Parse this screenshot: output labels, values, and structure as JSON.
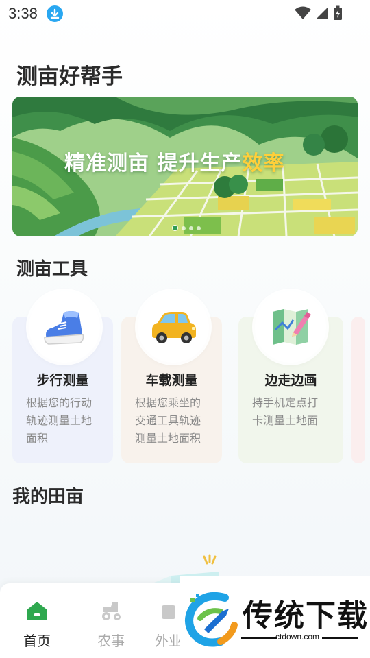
{
  "status_bar": {
    "time": "3:38"
  },
  "app": {
    "title": "测亩好帮手"
  },
  "banner": {
    "headline_main": "精准测亩  提升生产",
    "headline_accent": "效率",
    "dots_count": 4,
    "active_dot": 1
  },
  "tools_section": {
    "title": "测亩工具",
    "items": [
      {
        "name": "步行测量",
        "desc_lines": [
          "根据您的行动",
          "轨迹测量土地",
          "面积"
        ],
        "icon": "shoe-icon"
      },
      {
        "name": "车载测量",
        "desc_lines": [
          "根据您乘坐的",
          "交通工具轨迹",
          "测量土地面积"
        ],
        "icon": "car-icon"
      },
      {
        "name": "边走边画",
        "desc_lines": [
          "持手机定点打",
          "卡测量土地面"
        ],
        "icon": "map-pencil-icon"
      }
    ]
  },
  "fields_section": {
    "title": "我的田亩"
  },
  "nav": {
    "items": [
      {
        "label": "首页",
        "icon": "home-icon",
        "active": true
      },
      {
        "label": "农事",
        "icon": "tractor-icon",
        "active": false
      },
      {
        "label": "外业",
        "icon": "work-icon",
        "active": false
      }
    ]
  },
  "watermark": {
    "title": "传统下载",
    "url": "ctdown.com"
  },
  "colors": {
    "accent_green": "#2fa84f",
    "accent_yellow": "#ffcf3a"
  }
}
